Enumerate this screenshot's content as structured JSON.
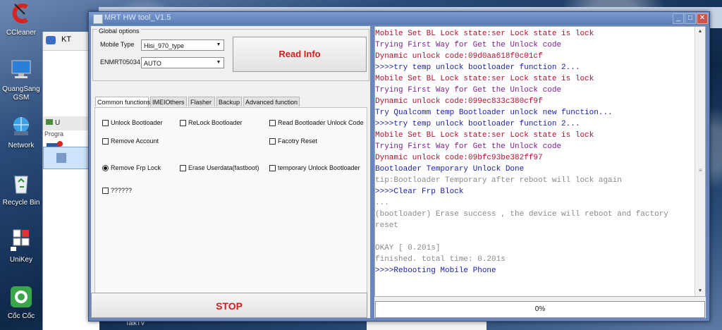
{
  "desktop": {
    "icons": [
      {
        "label": "CCleaner",
        "icon": "ccleaner-icon"
      },
      {
        "label": "QuangSang GSM",
        "icon": "computer-icon"
      },
      {
        "label": "Network",
        "icon": "network-icon"
      },
      {
        "label": "Recycle Bin",
        "icon": "recycle-bin-icon"
      },
      {
        "label": "UniKey",
        "icon": "unikey-icon"
      },
      {
        "label": "Cốc Cốc",
        "icon": "coccoc-icon"
      }
    ],
    "bg_labels": {
      "kt": "KT",
      "us": "U",
      "prog": "Progra"
    },
    "talktv": "TalkTV"
  },
  "window": {
    "title": "MRT HW tool_V1.5",
    "controls": {
      "minimize": "_",
      "maximize": "□",
      "close": "✕"
    }
  },
  "global_options": {
    "title": "Global options",
    "mobile_type_label": "Mobile Type",
    "mobile_type_value": "Hisi_970_type",
    "enmrt_label": "ENMRT05034",
    "enmrt_value": "AUTO",
    "read_info": "Read Info"
  },
  "tabs": [
    "Common functions",
    "IMEIOthers",
    "Flasher",
    "Backup",
    "Advanced function"
  ],
  "options": {
    "unlock_bootloader": "Unlock Bootloader",
    "relock_bootloader": "ReLock Bootloader",
    "read_unlock_code": "Read Bootloader Unlock Code",
    "remove_account": "Remove Account",
    "factory_reset": "Facotry Reset",
    "remove_frp": "Remove Frp Lock",
    "erase_userdata": "Erase Userdata(fastboot)",
    "temp_unlock": "temporary Unlock Bootloader",
    "unknown": "??????"
  },
  "stop": "STOP",
  "log": [
    {
      "text": "    Mobile Set BL Lock state:ser Lock state is lock",
      "color": "#b3122e"
    },
    {
      "text": "    Trying First Way for Get the Unlock code",
      "color": "#7a1f96"
    },
    {
      "text": "    Dynamic unlock code:09d0aa618f0c01cf",
      "color": "#b3122e"
    },
    {
      "text": ">>>>try temp unlock bootloader function 2...",
      "color": "#1c22a8"
    },
    {
      "text": "    Mobile Set BL Lock state:ser Lock state is lock",
      "color": "#b3122e"
    },
    {
      "text": "    Trying First Way for Get the Unlock code",
      "color": "#7a1f96"
    },
    {
      "text": "    Dynamic unlock code:099ec833c380cf9f",
      "color": "#b3122e"
    },
    {
      "text": "    Try Qualcomm temp Bootloader unlock new function...",
      "color": "#1c22a8"
    },
    {
      "text": ">>>>try temp unlock bootloader function 2...",
      "color": "#1c22a8"
    },
    {
      "text": "    Mobile Set BL Lock state:ser Lock state is lock",
      "color": "#b3122e"
    },
    {
      "text": "    Trying First Way for Get the Unlock code",
      "color": "#7a1f96"
    },
    {
      "text": "    Dynamic unlock code:09bfc93be382ff97",
      "color": "#b3122e"
    },
    {
      "text": "    Bootloader Temporary  Unlock Done",
      "color": "#1c22a8"
    },
    {
      "text": "    tip:Bootloader Temporary after reboot will lock again",
      "color": "#8a8a8a"
    },
    {
      "text": ">>>>Clear Frp Block",
      "color": "#1c22a8"
    },
    {
      "text": "    ...",
      "color": "#8a8a8a"
    },
    {
      "text": "    (bootloader)  Erase success , the device will reboot and factory",
      "color": "#8a8a8a"
    },
    {
      "text": "reset",
      "color": "#8a8a8a"
    },
    {
      "text": "",
      "color": "#8a8a8a"
    },
    {
      "text": "    OKAY [  0.201s]",
      "color": "#8a8a8a"
    },
    {
      "text": "    finished. total time: 0.201s",
      "color": "#8a8a8a"
    },
    {
      "text": ">>>>Rebooting Mobile Phone",
      "color": "#1c22a8"
    }
  ],
  "progress": {
    "text": "0%",
    "value": 0
  }
}
